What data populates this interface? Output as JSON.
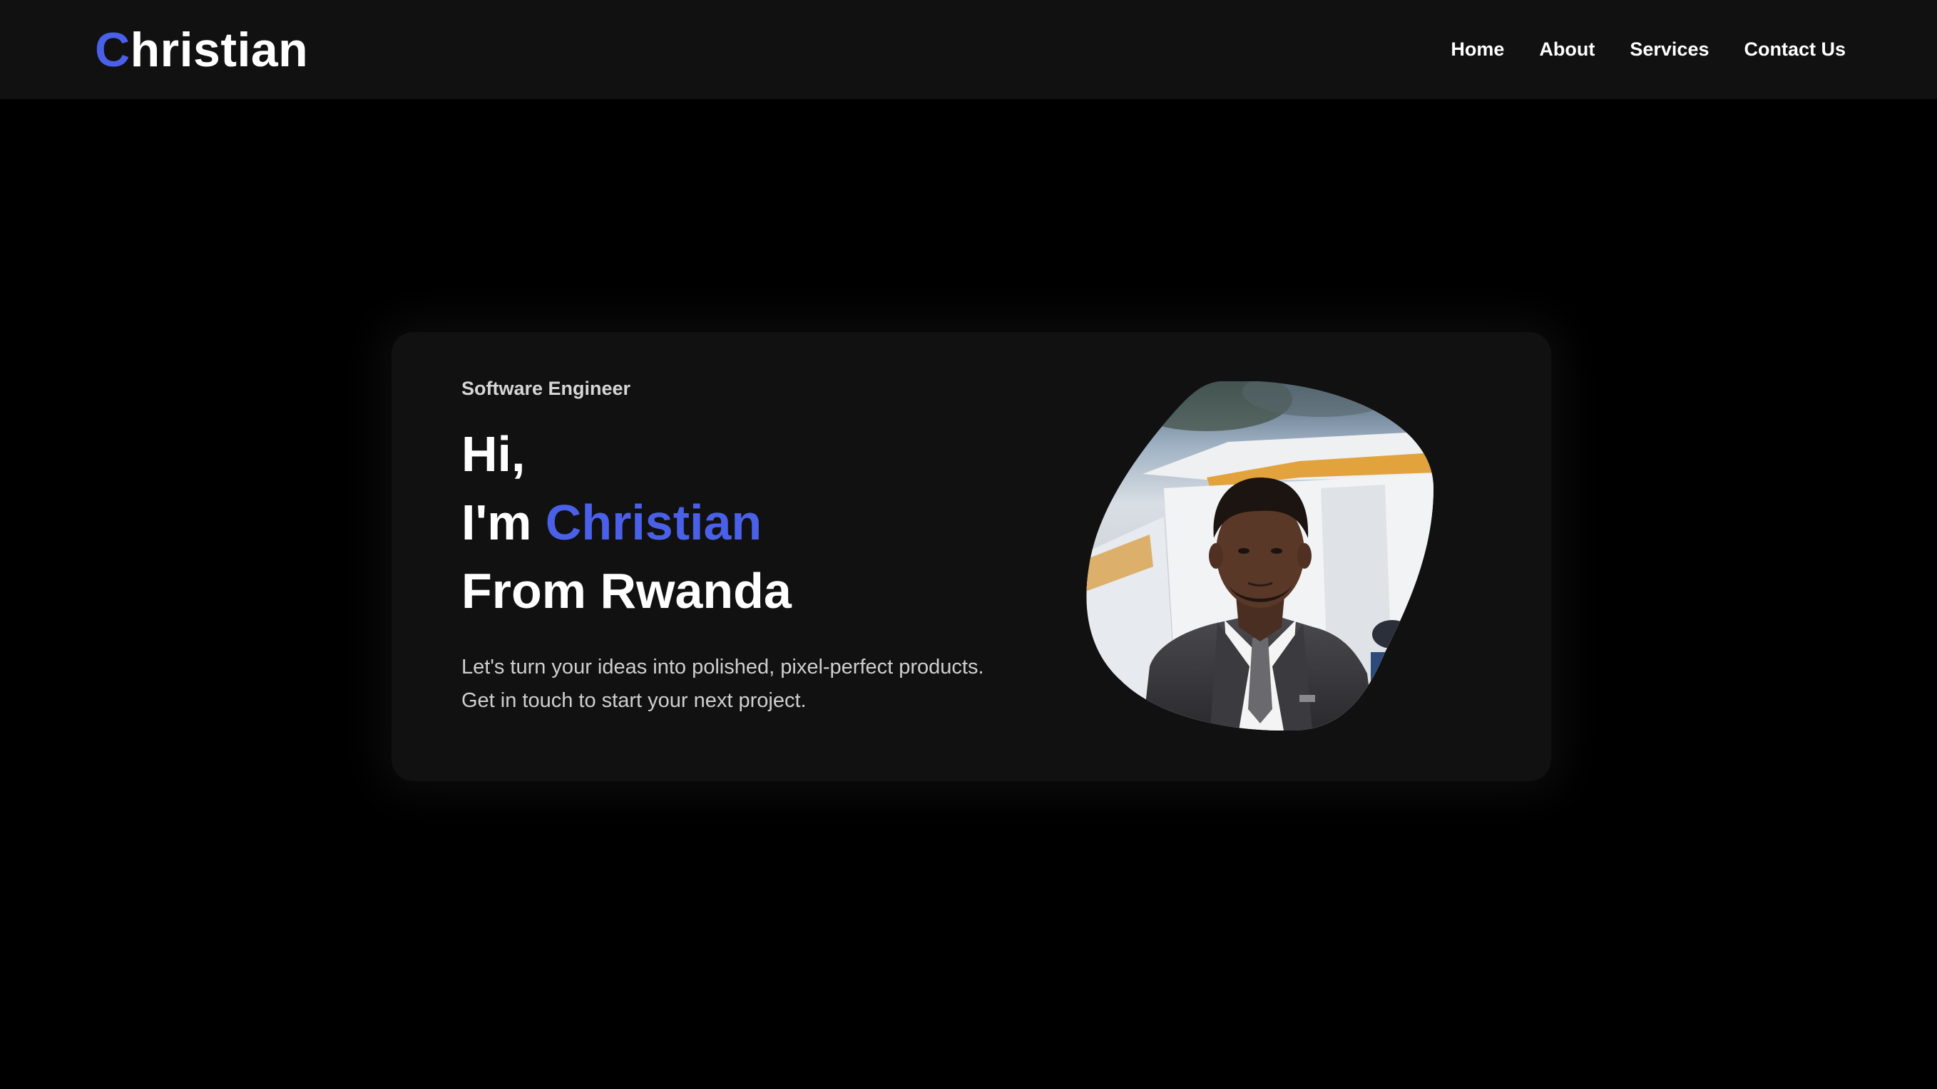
{
  "nav": {
    "logo_accent": "C",
    "logo_rest": "hristian",
    "links": [
      "Home",
      "About",
      "Services",
      "Contact Us"
    ]
  },
  "hero": {
    "subtitle": "Software Engineer",
    "line1": "Hi,",
    "line2_prefix": "I'm ",
    "line2_name": "Christian",
    "line3": "From Rwanda",
    "tagline_line1": "Let's turn your ideas into polished, pixel-perfect products.",
    "tagline_line2": "Get in touch to start your next project."
  },
  "colors": {
    "accent": "#4a60e8",
    "background": "#000000",
    "surface": "#111111"
  },
  "icons": {
    "portrait": "profile-photo"
  }
}
